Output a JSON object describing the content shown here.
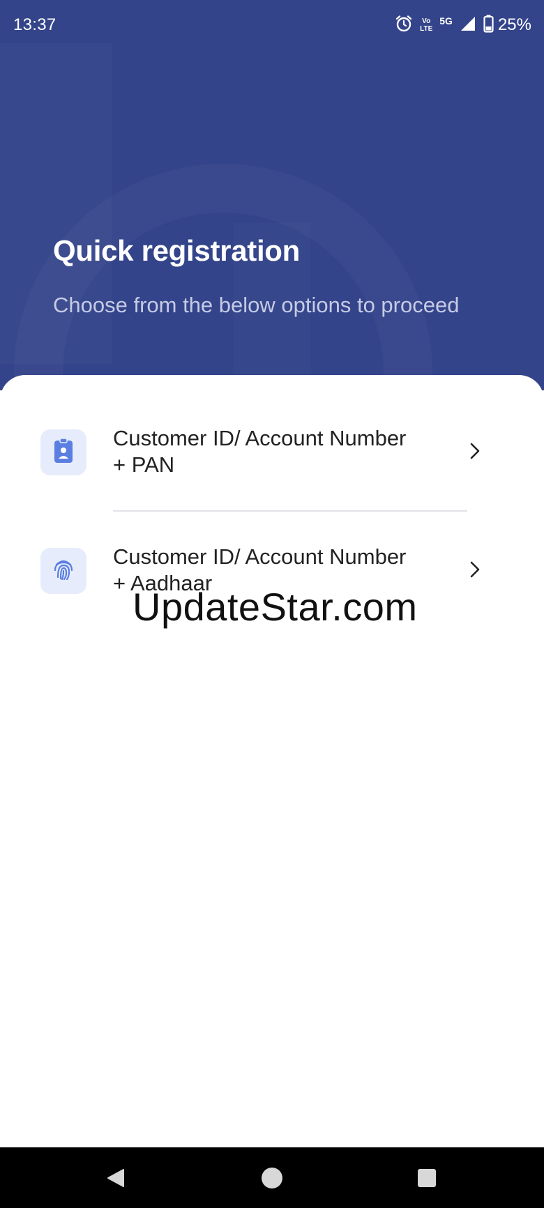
{
  "status_bar": {
    "time": "13:37",
    "volte_top": "Vo",
    "volte_bottom": "LTE",
    "network": "5G",
    "battery": "25%"
  },
  "header": {
    "title": "Quick registration",
    "subtitle": "Choose from the below options to proceed",
    "background_color": "#34448a"
  },
  "options": [
    {
      "label_line1": "Customer ID/ Account Number",
      "label_line2": "+ PAN",
      "icon": "id-card-icon"
    },
    {
      "label_line1": "Customer ID/ Account Number",
      "label_line2": "+ Aadhaar",
      "icon": "fingerprint-icon"
    }
  ],
  "watermark": "UpdateStar.com",
  "colors": {
    "accent": "#5b7fe0",
    "icon_tile": "#e6ecfb"
  },
  "nav_bar": {
    "back": "back-icon",
    "home": "home-icon",
    "recents": "recents-icon"
  }
}
